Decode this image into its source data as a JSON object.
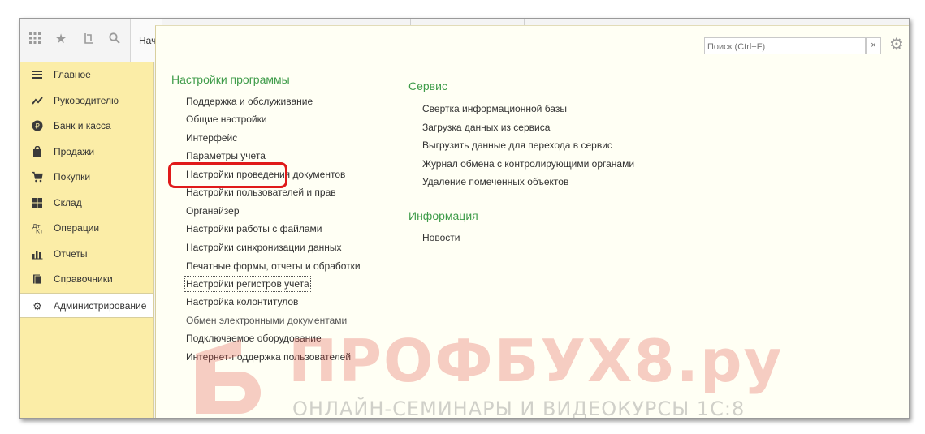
{
  "topbar": {
    "start_tab": "Нач"
  },
  "sidebar": {
    "items": [
      {
        "label": "Главное",
        "icon": "menu-icon"
      },
      {
        "label": "Руководителю",
        "icon": "trend-icon"
      },
      {
        "label": "Банк и касса",
        "icon": "ruble-coin-icon"
      },
      {
        "label": "Продажи",
        "icon": "shopping-bag-icon"
      },
      {
        "label": "Покупки",
        "icon": "cart-icon"
      },
      {
        "label": "Склад",
        "icon": "warehouse-grid-icon"
      },
      {
        "label": "Операции",
        "icon": "operations-icon"
      },
      {
        "label": "Отчеты",
        "icon": "bar-chart-icon"
      },
      {
        "label": "Справочники",
        "icon": "books-icon"
      },
      {
        "label": "Администрирование",
        "icon": "gear-icon",
        "active": true
      }
    ]
  },
  "search": {
    "placeholder": "Поиск (Ctrl+F)",
    "clear_label": "×"
  },
  "sections": {
    "settings": {
      "title": "Настройки программы",
      "links": [
        "Поддержка и обслуживание",
        "Общие настройки",
        "Интерфейс",
        "Параметры учета",
        "Настройки проведения документов",
        "Настройки пользователей и прав",
        "Органайзер",
        "Настройки работы с файлами",
        "Настройки синхронизации данных",
        "Печатные формы, отчеты и обработки",
        "Настройки регистров учета",
        "Настройка колонтитулов",
        "Обмен электронными документами",
        "Подключаемое оборудование",
        "Интернет-поддержка пользователей"
      ],
      "highlighted": "Параметры учета",
      "focused": "Настройки регистров учета"
    },
    "service": {
      "title": "Сервис",
      "links": [
        "Свертка информационной базы",
        "Загрузка данных из сервиса",
        "Выгрузить данные для перехода в сервис",
        "Журнал обмена с контролирующими органами",
        "Удаление помеченных объектов"
      ]
    },
    "info": {
      "title": "Информация",
      "links": [
        "Новости"
      ]
    }
  },
  "watermark": {
    "brand": "ПРОФБУХ8.ру",
    "tagline": "ОНЛАЙН-СЕМИНАРЫ И ВИДЕОКУРСЫ 1С:8"
  },
  "colors": {
    "sidebar_bg": "#fbeda7",
    "panel_bg": "#fffff4",
    "section_title": "#3f9c4a",
    "highlight": "#e01a1a"
  }
}
